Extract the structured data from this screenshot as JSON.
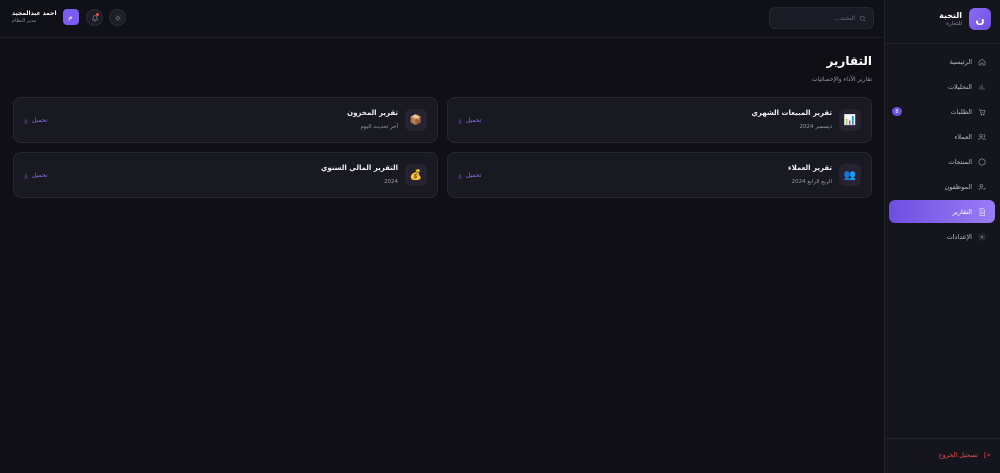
{
  "brand": {
    "logo_letter": "ن",
    "title": "النخبة",
    "subtitle": "للتجارة"
  },
  "nav": [
    {
      "label": "الرئيسية",
      "icon": "home-icon"
    },
    {
      "label": "التحليلات",
      "icon": "chart-icon"
    },
    {
      "label": "الطلبات",
      "icon": "cart-icon",
      "badge": "8"
    },
    {
      "label": "العملاء",
      "icon": "users-icon"
    },
    {
      "label": "المنتجات",
      "icon": "box-icon"
    },
    {
      "label": "الموظفون",
      "icon": "employee-icon"
    },
    {
      "label": "التقارير",
      "icon": "report-icon",
      "active": true
    },
    {
      "label": "الإعدادات",
      "icon": "gear-icon"
    }
  ],
  "logout_label": "تسجيل الخروج",
  "header": {
    "search_placeholder": "البحث...",
    "user_name": "احمد عبدالمجيد",
    "user_role": "مدير النظام",
    "avatar_letter": "م"
  },
  "page": {
    "title": "التقارير",
    "subtitle": "تقارير الأداء والإحصائيات"
  },
  "reports": [
    {
      "title": "تقرير المبيعات الشهري",
      "meta": "ديسمبر 2024",
      "icon": "📊",
      "download": "تحميل"
    },
    {
      "title": "تقرير المخزون",
      "meta": "آخر تحديث اليوم",
      "icon": "📦",
      "download": "تحميل"
    },
    {
      "title": "تقرير العملاء",
      "meta": "الربع الرابع 2024",
      "icon": "👥",
      "download": "تحميل"
    },
    {
      "title": "التقرير المالي السنوي",
      "meta": "2024",
      "icon": "💰",
      "download": "تحميل"
    }
  ],
  "colors": {
    "accent": "#7c5cf0",
    "danger": "#ef4a4a",
    "background": "#0f0f15"
  }
}
